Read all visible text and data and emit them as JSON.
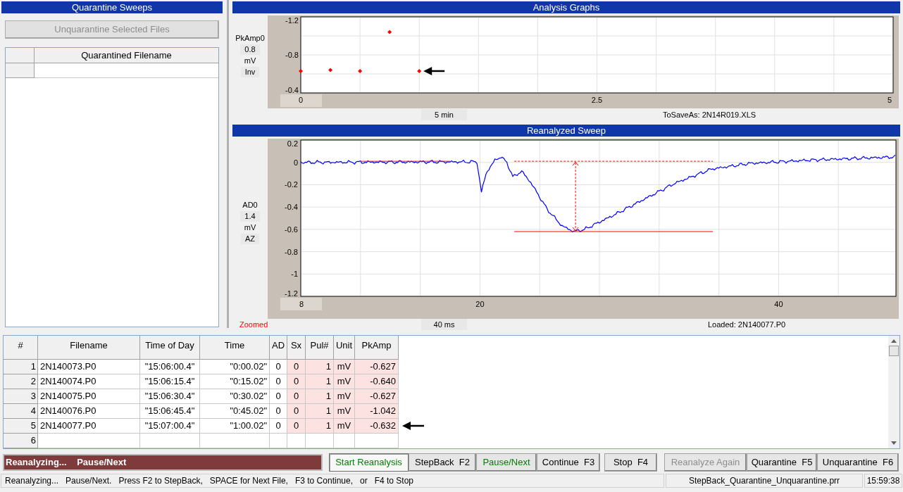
{
  "quarantine_panel": {
    "title": "Quarantine Sweeps",
    "button": {
      "label": "Unquarantine Selected Files",
      "disabled": true
    },
    "grid": {
      "columns": [
        "Quarantined Filename"
      ],
      "rows": [
        {
          "cells": [
            ""
          ]
        }
      ]
    }
  },
  "analysis_graphs": {
    "title": "Analysis Graphs",
    "side_labels": [
      {
        "text": "0.8",
        "boxed": true
      },
      {
        "text": "mV",
        "boxed": false
      },
      {
        "text": "Inv",
        "boxed": true
      }
    ],
    "chart_data": {
      "type": "scatter",
      "ylabel": "PkAmp0",
      "xlabel": "5 min",
      "x": [
        0,
        0.25,
        0.5,
        0.75,
        1
      ],
      "series": [
        {
          "color": "#ff0000",
          "values": [
            -0.63,
            -0.64,
            -0.63,
            -1.04,
            -0.63
          ]
        }
      ],
      "xlim": [
        0,
        5
      ],
      "ylim": [
        -0.4,
        -1.2
      ],
      "xticks": [
        0,
        2.5,
        5
      ],
      "yticks": [
        -1.2,
        -0.8,
        -0.4
      ]
    },
    "file_label": "ToSaveAs: 2N14R019.XLS"
  },
  "reanalyzed_sweep": {
    "title": "Reanalyzed Sweep",
    "side_labels": [
      {
        "text": "AD0",
        "boxed": false
      },
      {
        "text": "1.4",
        "boxed": true
      },
      {
        "text": "mV",
        "boxed": false
      },
      {
        "text": "AZ",
        "boxed": true
      }
    ],
    "y_tick_labels": [
      "0.2",
      "0",
      "-0.2",
      "-0.4",
      "-0.6",
      "-0.8",
      "-1",
      "-1.2"
    ],
    "x_tick_labels": [
      "8",
      "20",
      "40"
    ],
    "zoom_label": "Zoomed",
    "span_label": "40 ms",
    "file_label": "Loaded: 2N140077.P0"
  },
  "results_table": {
    "columns": [
      {
        "label": "#",
        "highlighted": false
      },
      {
        "label": "Filename",
        "highlighted": false
      },
      {
        "label": "Time of Day",
        "highlighted": false
      },
      {
        "label": "Time",
        "highlighted": false
      },
      {
        "label": "AD",
        "highlighted": false
      },
      {
        "label": "Sx",
        "highlighted": true
      },
      {
        "label": "Pul#",
        "highlighted": true
      },
      {
        "label": "Unit",
        "highlighted": true
      },
      {
        "label": "PkAmp",
        "highlighted": true
      }
    ],
    "rows": [
      {
        "cells": [
          "1",
          "2N140073.P0",
          "\"15:06:00.4\"",
          "\"0:00.02\"",
          "0",
          "0",
          "1",
          "mV",
          "-0.627"
        ],
        "current": false
      },
      {
        "cells": [
          "2",
          "2N140074.P0",
          "\"15:06:15.4\"",
          "\"0:15.02\"",
          "0",
          "0",
          "1",
          "mV",
          "-0.640"
        ],
        "current": false
      },
      {
        "cells": [
          "3",
          "2N140075.P0",
          "\"15:06:30.4\"",
          "\"0:30.02\"",
          "0",
          "0",
          "1",
          "mV",
          "-0.627"
        ],
        "current": false
      },
      {
        "cells": [
          "4",
          "2N140076.P0",
          "\"15:06:45.4\"",
          "\"0:45.02\"",
          "0",
          "0",
          "1",
          "mV",
          "-1.042"
        ],
        "current": false
      },
      {
        "cells": [
          "5",
          "2N140077.P0",
          "\"15:07:00.4\"",
          "\"1:00.02\"",
          "0",
          "0",
          "1",
          "mV",
          "-0.632"
        ],
        "current": true
      },
      {
        "cells": [
          "6"
        ],
        "current": false
      }
    ]
  },
  "status_banner": "Reanalyzing...    Pause/Next",
  "buttons": [
    {
      "label": "Start Reanalysis",
      "pressed": true,
      "highlighted": true,
      "disabled": false
    },
    {
      "label": "StepBack  F2",
      "pressed": false,
      "highlighted": false,
      "disabled": false
    },
    {
      "label": "Pause/Next",
      "pressed": false,
      "highlighted": true,
      "disabled": false
    },
    {
      "label": "Continue  F3",
      "pressed": false,
      "highlighted": false,
      "disabled": false
    },
    {
      "label": "Stop  F4",
      "pressed": false,
      "highlighted": false,
      "disabled": false
    },
    {
      "label": "Reanalyze Again",
      "pressed": false,
      "highlighted": false,
      "disabled": true
    },
    {
      "label": "Quarantine  F5",
      "pressed": false,
      "highlighted": false,
      "disabled": false
    },
    {
      "label": "Unquarantine  F6",
      "pressed": false,
      "highlighted": false,
      "disabled": false
    }
  ],
  "status_bar": {
    "message": "Reanalyzing...   Pause/Next.   Press F2 to StepBack,   SPACE for Next File,   F3 to Continue,   or   F4 to Stop",
    "file": "StepBack_Quarantine_Unquarantine.prr",
    "time": "15:59:38"
  }
}
